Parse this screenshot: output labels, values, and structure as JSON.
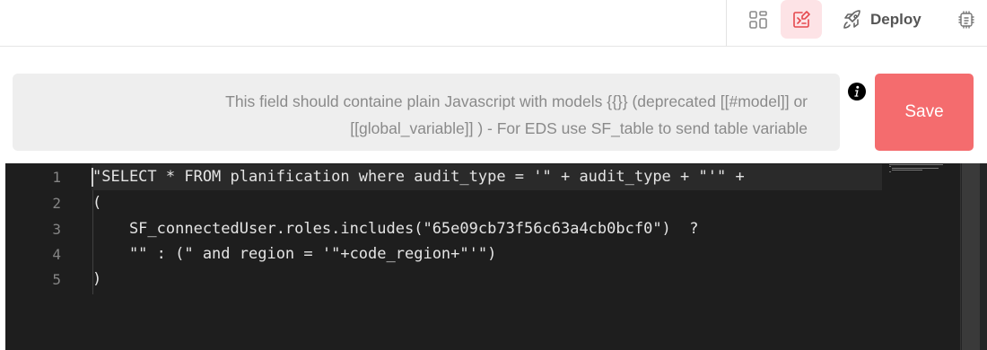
{
  "toolbar": {
    "grid_icon": "grid-layout-icon",
    "code_icon": "code-edit-icon",
    "deploy_icon": "rocket-icon",
    "deploy_label": "Deploy",
    "chip_icon": "chip-icon",
    "active_color": "#fde3e6",
    "active_icon_color": "#e5484d"
  },
  "hint": {
    "line1": "This field should containe plain Javascript with models {{}} (deprecated [[#model]] or",
    "line2": "[[global_variable]] ) - For EDS use SF_table to send table variable"
  },
  "info_icon": "info-icon",
  "save_button": {
    "label": "Save",
    "color": "#f46c6e"
  },
  "editor": {
    "line_numbers": [
      "1",
      "2",
      "3",
      "4",
      "5"
    ],
    "lines": [
      "\"SELECT * FROM planification where audit_type = '\" + audit_type + \"'\" +",
      "(",
      "    SF_connectedUser.roles.includes(\"65e09cb73f56c63a4cb0bcf0\")  ?",
      "    \"\" : (\" and region = '\"+code_region+\"'\")",
      ")"
    ],
    "background": "#1e1e1e"
  }
}
